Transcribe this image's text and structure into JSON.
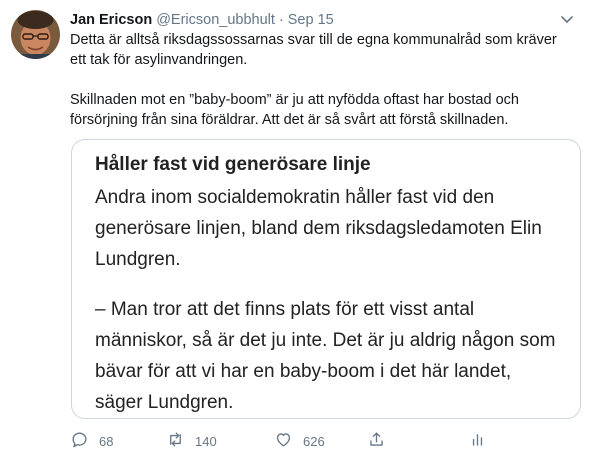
{
  "tweet": {
    "author": {
      "display_name": "Jan Ericson",
      "handle": "@Ericson_ubbhult",
      "separator": "·",
      "date": "Sep 15"
    },
    "text": [
      "Detta är alltså riksdagssossarnas svar till de egna kommunalråd som kräver ett tak för asylinvandringen.",
      "Skillnaden mot en ”baby-boom” är ju att nyfödda oftast har bostad och försörjning från sina föräldrar. Att det är så svårt att förstå skillnaden."
    ],
    "attached_image": {
      "heading": "Håller fast vid generösare linje",
      "paragraph_1": "Andra inom socialdemokratin håller fast vid den generösare linjen, bland dem riksdagsledamoten Elin Lundgren.",
      "paragraph_2": "– Man tror att det finns plats för ett visst antal människor, så är det ju inte. Det är ju aldrig någon som bävar för att vi har en baby-boom i det här landet, säger Lundgren."
    },
    "actions": {
      "reply": {
        "icon": "reply-icon",
        "count": "68"
      },
      "retweet": {
        "icon": "retweet-icon",
        "count": "140"
      },
      "like": {
        "icon": "heart-icon",
        "count": "626"
      },
      "share": {
        "icon": "share-icon"
      },
      "analytics": {
        "icon": "analytics-icon"
      }
    }
  },
  "colors": {
    "text_primary": "#14171a",
    "text_secondary": "#657786",
    "border": "#ccd6dd",
    "background": "#ffffff"
  }
}
